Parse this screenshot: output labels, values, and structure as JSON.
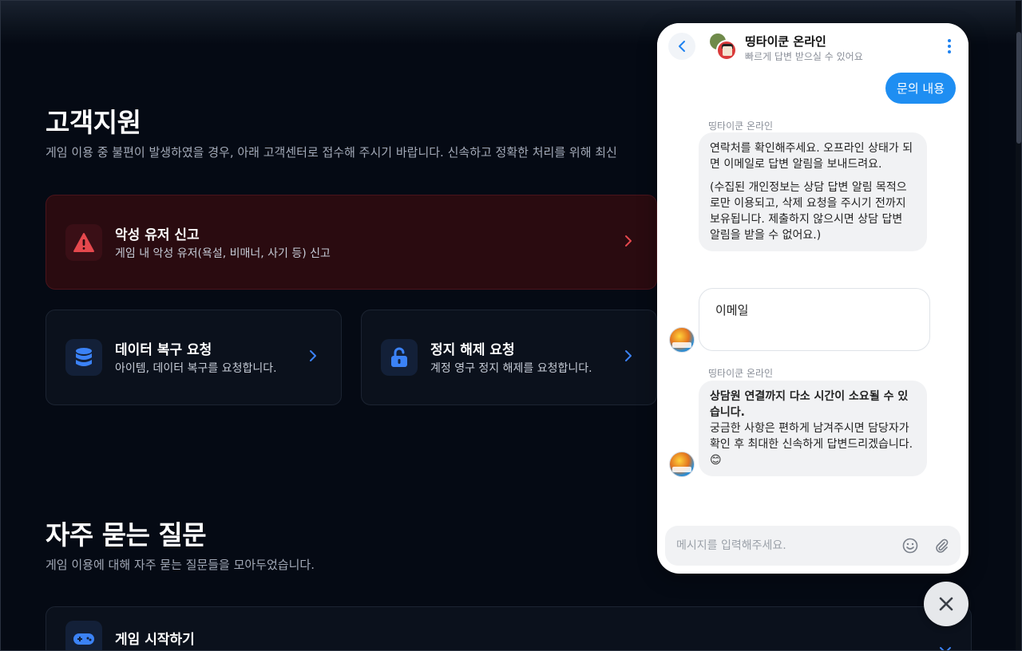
{
  "support": {
    "title": "고객지원",
    "description": "게임 이용 중 불편이 발생하였을 경우, 아래 고객센터로 접수해 주시기 바랍니다. 신속하고 정확한 처리를 위해 최신"
  },
  "cards": {
    "report": {
      "title": "악성 유저 신고",
      "subtitle": "게임 내 악성 유저(욕설, 비매너, 사기 등) 신고"
    },
    "recovery": {
      "title": "데이터 복구 요청",
      "subtitle": "아이템, 데이터 복구를 요청합니다."
    },
    "unban": {
      "title": "정지 해제 요청",
      "subtitle": "계정 영구 정지 해제를 요청합니다."
    }
  },
  "faq": {
    "title": "자주 묻는 질문",
    "description": "게임 이용에 대해 자주 묻는 질문들을 모아두었습니다.",
    "items": [
      {
        "title": "게임 시작하기"
      }
    ]
  },
  "chat": {
    "name": "띵타이쿤 온라인",
    "status": "빠르게 답변 받으실 수 있어요",
    "user_message": "문의 내용",
    "sender_1": "띵타이쿤 온라인",
    "bot_message_1a": "연락처를 확인해주세요. 오프라인 상태가 되면 이메일로 답변 알림을 보내드려요.",
    "bot_message_1b": "(수집된 개인정보는 상담 답변 알림 목적으로만 이용되고, 삭제 요청을 주시기 전까지 보유됩니다. 제출하지 않으시면 상담 답변 알림을 받을 수 없어요.)",
    "email_label": "이메일",
    "sender_2": "띵타이쿤 온라인",
    "bot_message_2_bold": "상담원 연결까지 다소 시간이 소요될 수 있습니다.",
    "bot_message_2": "궁금한 사항은 편하게 남겨주시면 담당자가 확인 후 최대한 신속하게 답변드리겠습니다. 😊",
    "input_placeholder": "메시지를 입력해주세요."
  },
  "icons": {
    "warning": "warning-icon",
    "database": "database-icon",
    "unlock": "unlock-icon",
    "gamepad": "gamepad-icon",
    "back": "chevron-left-icon",
    "more": "more-vertical-icon",
    "emoji": "smile-icon",
    "attach": "paperclip-icon",
    "close": "close-icon"
  },
  "colors": {
    "page_bg": "#050a14",
    "danger_card_bg": "#2a0b10",
    "danger_accent": "#e5484d",
    "blue_accent": "#3b82f6",
    "chat_accent": "#1e8ef2"
  }
}
